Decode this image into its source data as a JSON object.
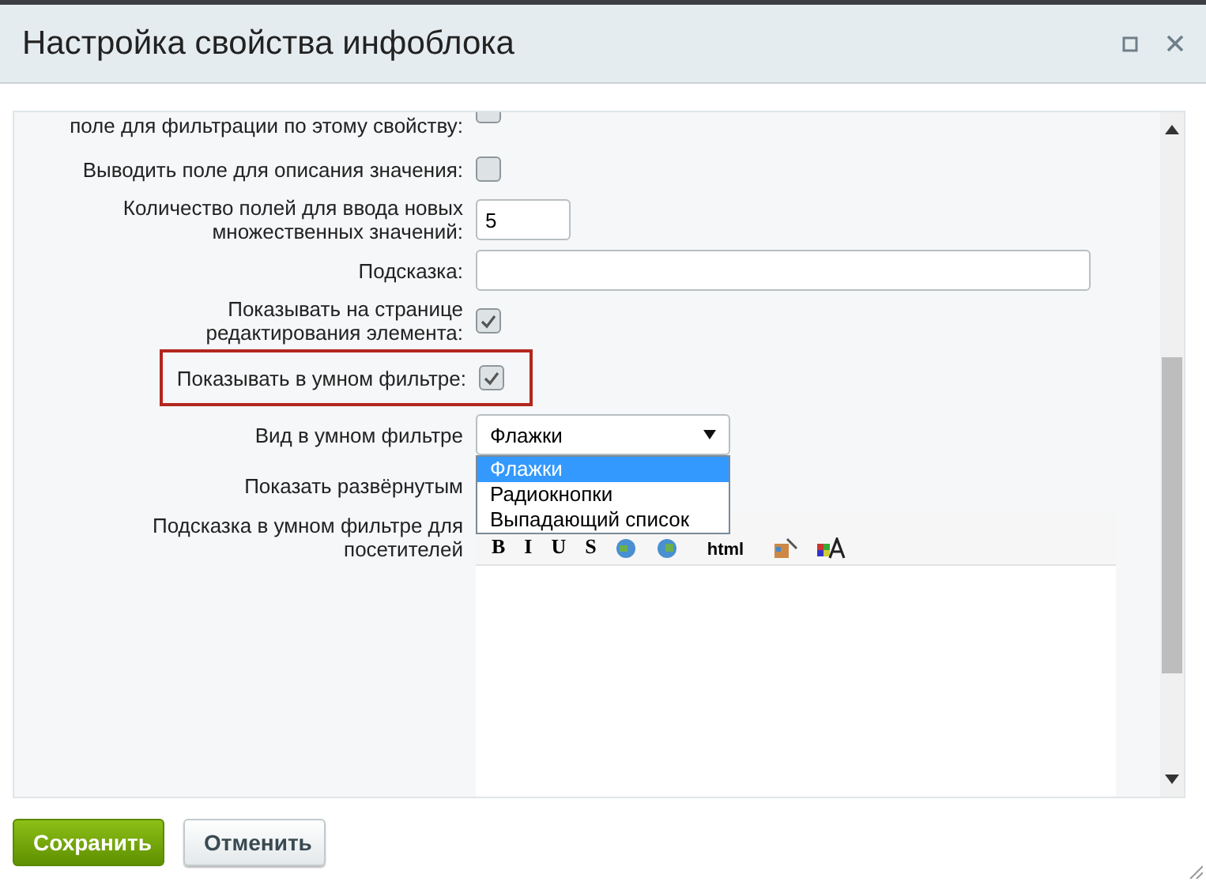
{
  "window": {
    "title": "Настройка свойства инфоблока"
  },
  "rows": [
    {
      "kind": "checkbox",
      "label": "поле для фильтрации по этому свойству:",
      "checked": false,
      "highlighted": false
    },
    {
      "kind": "checkbox",
      "label": "Выводить поле для описания значения:",
      "checked": false,
      "highlighted": false
    },
    {
      "kind": "number",
      "label": "Количество полей для ввода новых множественных значений:",
      "value": "5",
      "highlighted": false
    },
    {
      "kind": "text",
      "label": "Подсказка:",
      "highlighted": false
    },
    {
      "kind": "checkbox",
      "label": "Показывать на странице редактирования элемента:",
      "checked": true,
      "highlighted": false
    },
    {
      "kind": "checkbox",
      "label": "Показывать в умном фильтре:",
      "checked": true,
      "highlighted": true
    },
    {
      "kind": "select",
      "label": "Вид в умном фильтре",
      "value": "Флажки",
      "expanded": true,
      "highlighted": false,
      "options": [
        {
          "label": "Флажки",
          "selected": true
        },
        {
          "label": "Радиокнопки",
          "selected": false
        },
        {
          "label": "Выпадающий список",
          "selected": false
        }
      ]
    },
    {
      "kind": "plain",
      "label": "Показать развёрнутым",
      "highlighted": false
    },
    {
      "kind": "editor",
      "label": "Подсказка в умном фильтре для посетителей",
      "highlighted": false,
      "toolbar": [
        {
          "kind": "text",
          "label": "B"
        },
        {
          "kind": "text",
          "label": "I"
        },
        {
          "kind": "text",
          "label": "U"
        },
        {
          "kind": "text",
          "label": "S"
        },
        {
          "kind": "link"
        },
        {
          "kind": "unlink"
        },
        {
          "kind": "text",
          "label": "html"
        },
        {
          "kind": "image"
        },
        {
          "kind": "font"
        }
      ]
    }
  ],
  "buttons": [
    {
      "label": "Сохранить",
      "kind": "primary"
    },
    {
      "label": "Отменить",
      "kind": "secondary"
    }
  ]
}
